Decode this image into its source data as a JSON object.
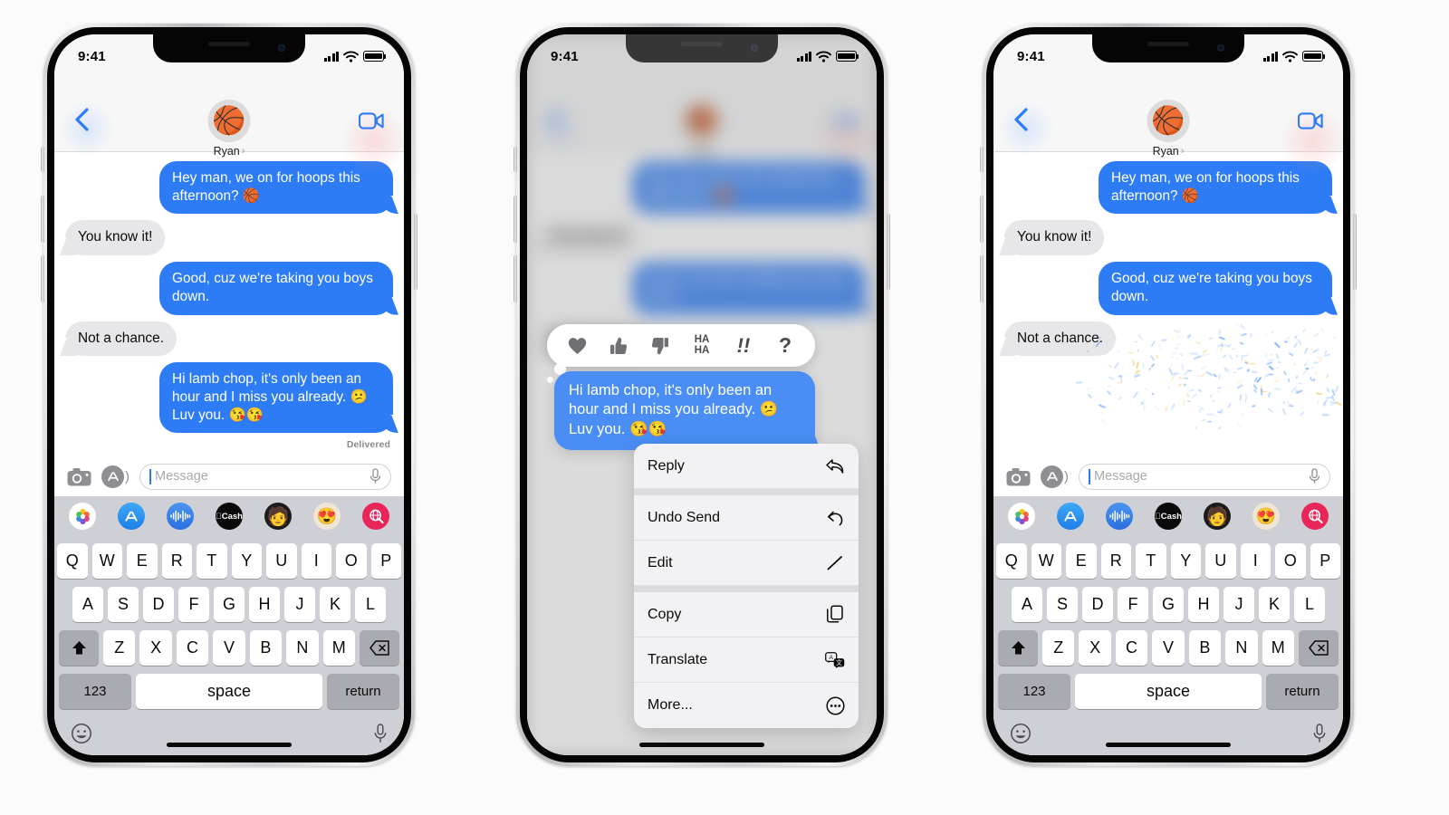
{
  "statusbar": {
    "time": "9:41",
    "signal_icon": "cellular-bars-icon",
    "wifi_icon": "wifi-icon",
    "battery_icon": "battery-icon"
  },
  "header": {
    "back_icon": "back-chevron-icon",
    "facetime_icon": "facetime-video-icon",
    "avatar_emoji": "🏀",
    "contact_name": "Ryan",
    "chevron": "›"
  },
  "conversation": {
    "messages": [
      {
        "id": "m1",
        "side": "out",
        "text": "Hey man, we on for hoops this afternoon? 🏀"
      },
      {
        "id": "m2",
        "side": "in",
        "text": "You know it!"
      },
      {
        "id": "m3",
        "side": "out",
        "text": "Good, cuz we're taking you boys down."
      },
      {
        "id": "m4",
        "side": "in",
        "text": "Not a chance."
      },
      {
        "id": "m5",
        "side": "out",
        "text": "Hi lamb chop, it's only been an hour and I miss you already. 😕 Luv you. 😘😘"
      }
    ],
    "delivered_label": "Delivered"
  },
  "inputbar": {
    "camera_icon": "camera-icon",
    "appstore_icon": "app-store-icon",
    "placeholder": "Message",
    "mic_icon": "microphone-icon"
  },
  "appdrawer": {
    "apps": [
      {
        "name": "photos-app-icon",
        "label": ""
      },
      {
        "name": "app-store-app-icon",
        "label": ""
      },
      {
        "name": "audio-message-app-icon",
        "label": ""
      },
      {
        "name": "apple-cash-app-icon",
        "label": "Cash"
      },
      {
        "name": "memoji-app-icon",
        "label": "🧑"
      },
      {
        "name": "stickers-app-icon",
        "label": "😍"
      },
      {
        "name": "images-search-app-icon",
        "label": ""
      }
    ]
  },
  "keyboard": {
    "row1": [
      "Q",
      "W",
      "E",
      "R",
      "T",
      "Y",
      "U",
      "I",
      "O",
      "P"
    ],
    "row2": [
      "A",
      "S",
      "D",
      "F",
      "G",
      "H",
      "J",
      "K",
      "L"
    ],
    "row3": [
      "Z",
      "X",
      "C",
      "V",
      "B",
      "N",
      "M"
    ],
    "shift_icon": "shift-up-arrow-icon",
    "backspace_icon": "backspace-delete-icon",
    "numbers_label": "123",
    "space_label": "space",
    "return_label": "return",
    "emoji_icon": "emoji-smiley-icon",
    "dictation_icon": "microphone-icon"
  },
  "tapbacks": {
    "items": [
      {
        "name": "tapback-heart",
        "glyph": "♥"
      },
      {
        "name": "tapback-thumbs-up",
        "glyph": "👍"
      },
      {
        "name": "tapback-thumbs-down",
        "glyph": "👎"
      },
      {
        "name": "tapback-haha",
        "glyph": "HA\nHA"
      },
      {
        "name": "tapback-exclamation",
        "glyph": "‼"
      },
      {
        "name": "tapback-question",
        "glyph": "?"
      }
    ]
  },
  "context_menu": {
    "items": [
      {
        "label": "Reply",
        "icon": "reply-arrow-icon"
      },
      {
        "label": "Undo Send",
        "icon": "undo-arrow-icon"
      },
      {
        "label": "Edit",
        "icon": "pencil-edit-icon"
      },
      {
        "label": "Copy",
        "icon": "copy-pages-icon"
      },
      {
        "label": "Translate",
        "icon": "translate-bubbles-icon"
      },
      {
        "label": "More...",
        "icon": "more-ellipsis-circle-icon"
      }
    ]
  },
  "colors": {
    "imessage_blue": "#2d7cf6",
    "incoming_grey": "#e7e7ea",
    "accent_blue": "#2d7cf6",
    "keyboard_bg": "#cfcfd6",
    "nav_bg": "#f7f7f7"
  }
}
